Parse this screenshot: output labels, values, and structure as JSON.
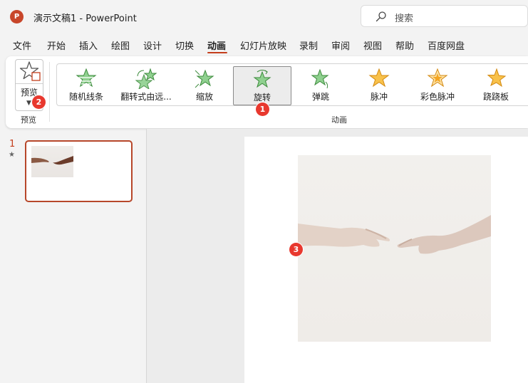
{
  "app": {
    "logo_letter": "P",
    "title": "演示文稿1  -  PowerPoint"
  },
  "search": {
    "placeholder": "搜索"
  },
  "menu": {
    "items": [
      "文件",
      "开始",
      "插入",
      "绘图",
      "设计",
      "切换",
      "动画",
      "幻灯片放映",
      "录制",
      "审阅",
      "视图",
      "帮助",
      "百度网盘"
    ],
    "active_index": 6
  },
  "ribbon": {
    "preview": {
      "label": "预览",
      "group_label": "预览"
    },
    "animations": {
      "group_label": "动画",
      "items": [
        {
          "label": "随机线条",
          "icon": "random-bars-star-icon",
          "selected": false
        },
        {
          "label": "翻转式由远...",
          "icon": "flip-star-icon",
          "selected": false
        },
        {
          "label": "缩放",
          "icon": "zoom-star-icon",
          "selected": false
        },
        {
          "label": "旋转",
          "icon": "spin-star-icon",
          "selected": true
        },
        {
          "label": "弹跳",
          "icon": "bounce-star-icon",
          "selected": false
        },
        {
          "label": "脉冲",
          "icon": "pulse-star-icon",
          "selected": false
        },
        {
          "label": "彩色脉冲",
          "icon": "color-pulse-star-icon",
          "selected": false
        },
        {
          "label": "跷跷板",
          "icon": "teeter-star-icon",
          "selected": false
        }
      ]
    }
  },
  "badges": [
    "1",
    "2",
    "3"
  ],
  "slides": [
    {
      "number": "1",
      "has_animation": "★"
    }
  ],
  "colors": {
    "accent": "#c43e1c",
    "green_star": "#7ac47a",
    "gold_star": "#f5b335",
    "badge": "#e8382e"
  }
}
